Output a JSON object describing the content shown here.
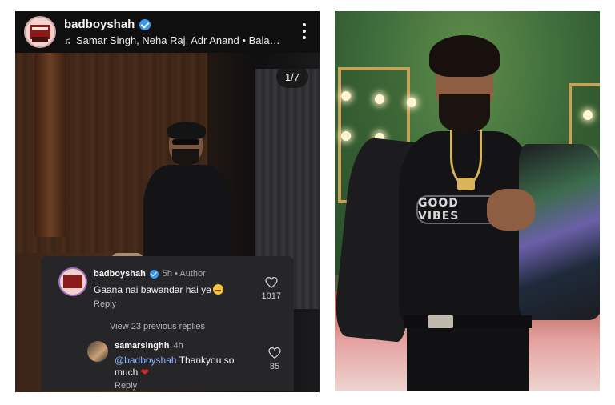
{
  "post": {
    "username": "badboyshah",
    "music_line": "Samar Singh, Neha Raj, Adr Anand • Bala…",
    "music_icon": "music-note-icon",
    "counter": "1/7"
  },
  "comments": {
    "first": {
      "username": "badboyshah",
      "meta": "5h • Author",
      "text": "Gaana nai bawandar hai ye",
      "reply": "Reply",
      "likes": "1017"
    },
    "view_previous": "View 23 previous replies",
    "second": {
      "username": "samarsinghh",
      "meta": "4h",
      "mention": "@badboyshah",
      "text": " Thankyou so much ",
      "reply": "Reply",
      "likes": "85"
    }
  },
  "right_photo": {
    "tee_text": "GOOD VIBES"
  },
  "colors": {
    "verified": "#3897f0",
    "mention": "#8ab4ff",
    "heart": "#e0262b"
  }
}
